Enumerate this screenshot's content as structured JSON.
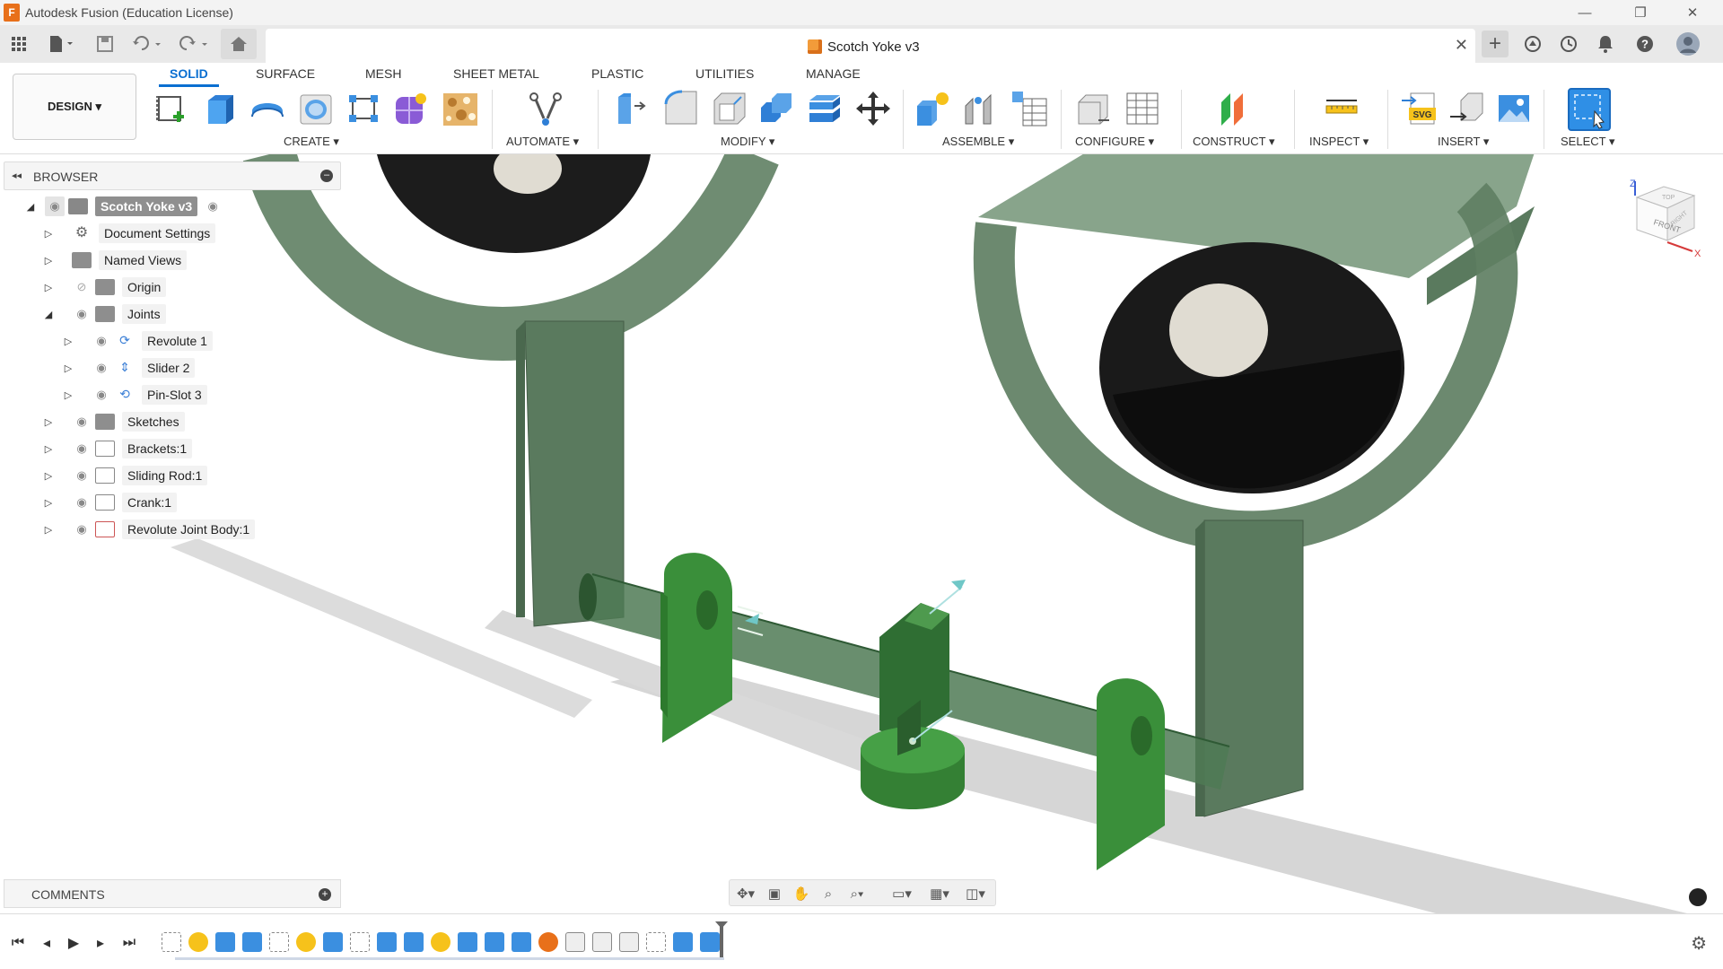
{
  "titlebar": {
    "app_logo_letter": "F",
    "title": "Autodesk Fusion (Education License)",
    "minimize_glyph": "—",
    "restore_glyph": "❐",
    "close_glyph": "✕"
  },
  "tabbar": {
    "document_title": "Scotch Yoke v3",
    "close_glyph": "✕",
    "new_tab_glyph": "+"
  },
  "ribbon": {
    "workspace_label": "DESIGN ▾",
    "tabs": [
      "SOLID",
      "SURFACE",
      "MESH",
      "SHEET METAL",
      "PLASTIC",
      "UTILITIES",
      "MANAGE"
    ],
    "active_tab": "SOLID",
    "groups": {
      "create": "CREATE ▾",
      "automate": "AUTOMATE ▾",
      "modify": "MODIFY ▾",
      "assemble": "ASSEMBLE ▾",
      "configure": "CONFIGURE ▾",
      "construct": "CONSTRUCT ▾",
      "inspect": "INSPECT ▾",
      "insert": "INSERT ▾",
      "select": "SELECT ▾"
    },
    "svg_badge": "SVG"
  },
  "browser": {
    "title": "BROWSER",
    "collapse_glyph": "◂◂",
    "root": "Scotch Yoke v3",
    "items": [
      {
        "label": "Document Settings"
      },
      {
        "label": "Named Views"
      },
      {
        "label": "Origin"
      },
      {
        "label": "Joints"
      },
      {
        "label": "Revolute 1"
      },
      {
        "label": "Slider 2"
      },
      {
        "label": "Pin-Slot 3"
      },
      {
        "label": "Sketches"
      },
      {
        "label": "Brackets:1"
      },
      {
        "label": "Sliding Rod:1"
      },
      {
        "label": "Crank:1"
      },
      {
        "label": "Revolute Joint Body:1"
      }
    ]
  },
  "comments": {
    "title": "COMMENTS",
    "add_glyph": "+"
  },
  "viewcube": {
    "front_label": "FRONT",
    "top_label": "TOP",
    "right_label": "RIGHT",
    "axis_z": "Z",
    "axis_x": "X"
  },
  "colors": {
    "accent": "#0a6fd1",
    "bracket_green": "#55785a",
    "part_green": "#3f9a3f",
    "wheel_black": "#1a1a1a",
    "shadow": "#d8d8d8"
  },
  "icons": [
    "grid-menu-icon",
    "file-icon",
    "save-icon",
    "undo-icon",
    "redo-icon",
    "home-icon",
    "new-tab-icon",
    "extensions-icon",
    "job-status-icon",
    "notifications-icon",
    "help-icon",
    "avatar",
    "orbit-icon",
    "look-at-icon",
    "pan-icon",
    "zoom-icon",
    "fit-icon",
    "display-settings-icon",
    "grid-settings-icon",
    "viewports-icon",
    "play-first-icon",
    "play-prev-icon",
    "play-icon",
    "play-next-icon",
    "play-last-icon",
    "timeline-settings-icon"
  ]
}
